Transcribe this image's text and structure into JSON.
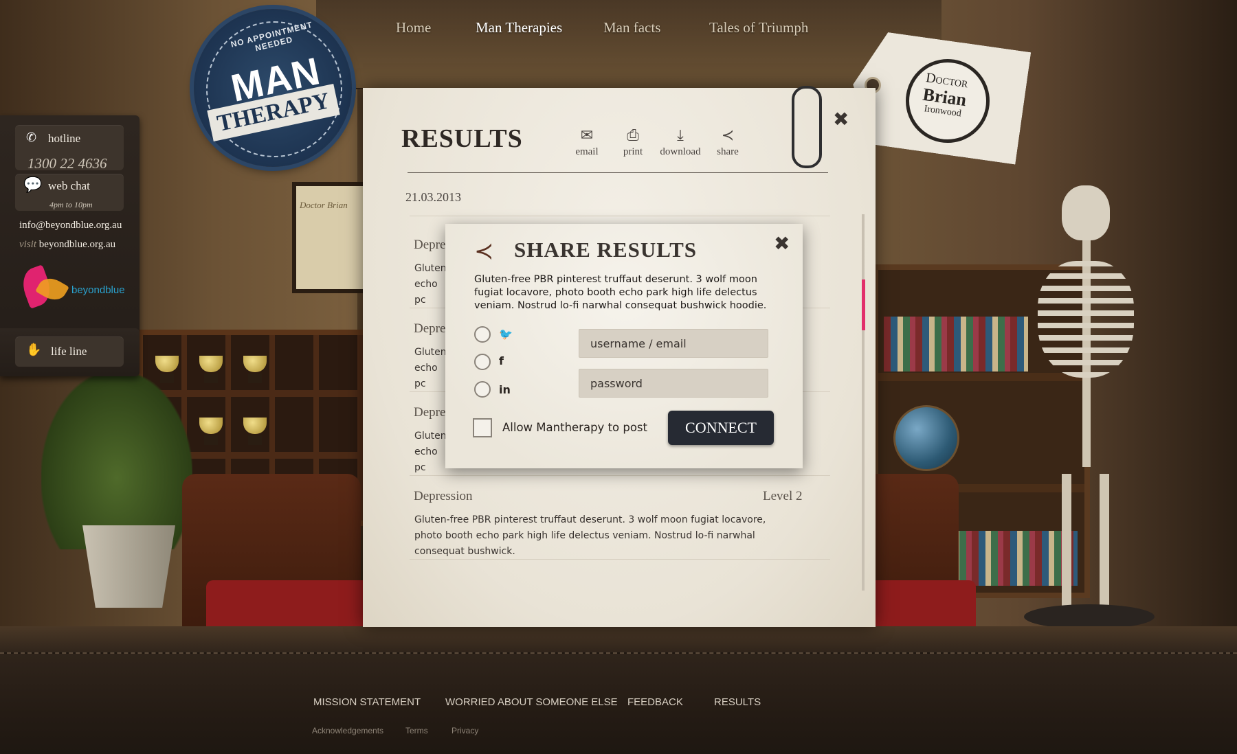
{
  "logo": {
    "top_text": "NO APPOINTMENT NEEDED",
    "line1": "MAN",
    "line2": "THERAPY"
  },
  "nav": {
    "items": [
      {
        "label": "Home"
      },
      {
        "label": "Man Therapies"
      },
      {
        "label": "Man facts"
      },
      {
        "label": "Tales of Triumph"
      }
    ],
    "active": "Man Therapies"
  },
  "sidebar": {
    "hotline_label": "hotline",
    "hotline_number": "1300 22 4636",
    "webchat_label": "web chat",
    "webchat_hours": "4pm to 10pm",
    "email": "info@beyondblue.org.au",
    "visit_prefix": "visit",
    "visit_url": "beyondblue.org.au",
    "partner_logo_text": "beyondblue",
    "lifeline_label": "life line"
  },
  "background": {
    "diploma_text": "Doctor Brian"
  },
  "tag": {
    "line1": "Doctor",
    "line2": "Brian",
    "line3": "Ironwood"
  },
  "results": {
    "title": "RESULTS",
    "tools": [
      {
        "label": "email",
        "icon": "envelope-icon"
      },
      {
        "label": "print",
        "icon": "printer-icon"
      },
      {
        "label": "download",
        "icon": "download-icon"
      },
      {
        "label": "share",
        "icon": "share-icon"
      }
    ],
    "date": "21.03.2013",
    "rows": [
      {
        "category": "Depre",
        "level": "",
        "desc": "Gluten-\necho pc"
      },
      {
        "category": "Depre",
        "level": "",
        "desc": "Gluten-\necho pc"
      },
      {
        "category": "Depre",
        "level": "",
        "desc": "Gluten-\necho pc"
      },
      {
        "category": "Depression",
        "level": "Level 2",
        "desc": "Gluten-free PBR pinterest truffaut deserunt. 3 wolf moon fugiat locavore, photo booth echo park high life delectus veniam. Nostrud lo-fi narwhal consequat bushwick."
      }
    ],
    "scroll_position": 0.2
  },
  "share_modal": {
    "title": "SHARE RESULTS",
    "description": "Gluten-free PBR pinterest truffaut deserunt. 3 wolf moon fugiat locavore, photo booth echo park high life delectus veniam. Nostrud lo-fi narwhal consequat bushwick hoodie.",
    "networks": [
      {
        "name": "twitter",
        "icon": "twitter-icon",
        "glyph": "🐦"
      },
      {
        "name": "facebook",
        "icon": "facebook-icon",
        "glyph": "f"
      },
      {
        "name": "linkedin",
        "icon": "linkedin-icon",
        "glyph": "in"
      }
    ],
    "username_placeholder": "username / email",
    "password_placeholder": "password",
    "allow_label": "Allow Mantherapy to post",
    "allow_checked": false,
    "connect_label": "CONNECT"
  },
  "footer": {
    "links": [
      "MISSION STATEMENT",
      "WORRIED ABOUT SOMEONE ELSE",
      "FEEDBACK",
      "RESULTS"
    ],
    "small_links": [
      "Acknowledgements",
      "Terms",
      "Privacy"
    ]
  },
  "colors": {
    "accent_pink": "#e22e6a",
    "connect_button": "#262a33",
    "logo_navy": "#1d3350",
    "partner_blue": "#2aa3d0"
  }
}
